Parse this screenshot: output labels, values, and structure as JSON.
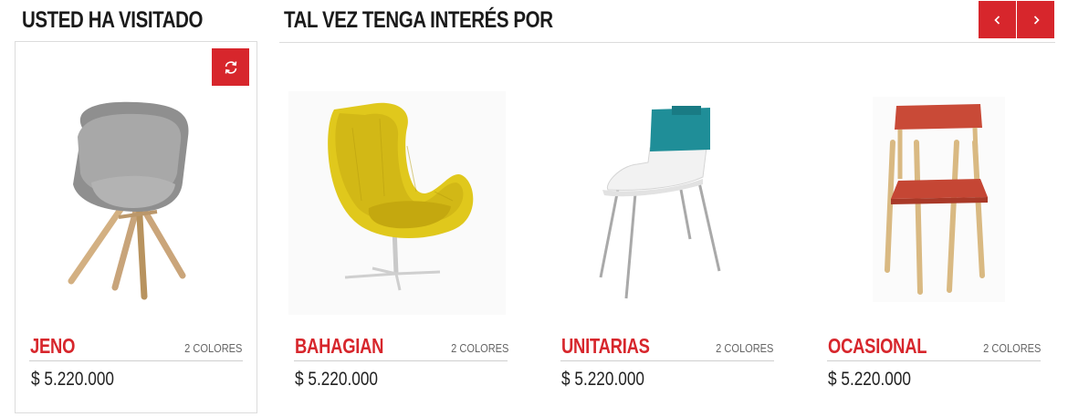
{
  "sections": {
    "visited_title": "USTED HA VISITADO",
    "interest_title": "TAL VEZ TENGA INTERÉS POR"
  },
  "nav": {
    "prev_icon": "chevron-left-icon",
    "next_icon": "chevron-right-icon"
  },
  "refresh_icon": "refresh-icon",
  "colors": {
    "accent": "#d7262c",
    "border": "#dcdcdc"
  },
  "visited": [
    {
      "name": "JENO",
      "colors": "2 COLORES",
      "price": "$ 5.220.000"
    }
  ],
  "recommended": [
    {
      "name": "BAHAGIAN",
      "colors": "2 COLORES",
      "price": "$ 5.220.000"
    },
    {
      "name": "UNITARIAS",
      "colors": "2 COLORES",
      "price": "$ 5.220.000"
    },
    {
      "name": "OCASIONAL",
      "colors": "2 COLORES",
      "price": "$ 5.220.000"
    }
  ]
}
